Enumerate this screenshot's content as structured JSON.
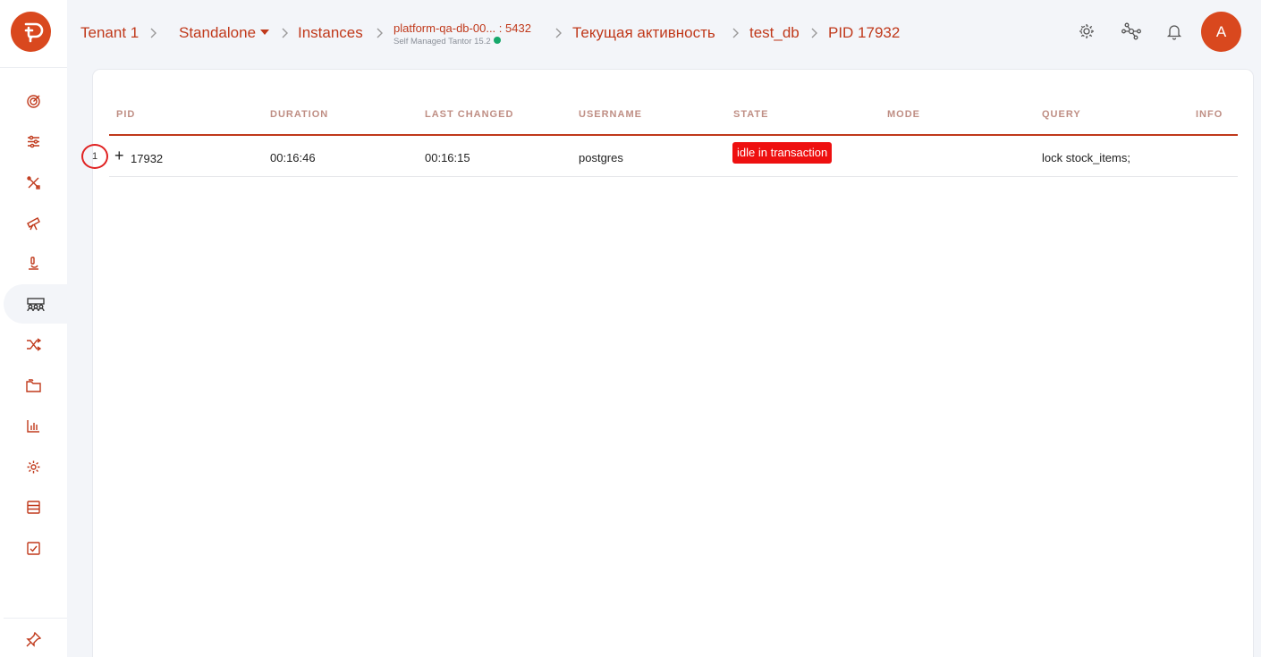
{
  "sidebar": {
    "items": [
      {
        "icon": "target-icon"
      },
      {
        "icon": "sliders-icon"
      },
      {
        "icon": "tools-icon"
      },
      {
        "icon": "telescope-icon"
      },
      {
        "icon": "microscope-icon"
      },
      {
        "icon": "users-icon",
        "active": true
      },
      {
        "icon": "shuffle-icon"
      },
      {
        "icon": "folders-icon"
      },
      {
        "icon": "bar-chart-icon"
      },
      {
        "icon": "gear-icon"
      },
      {
        "icon": "database-icon"
      },
      {
        "icon": "checklist-icon"
      }
    ],
    "pin_icon": "pin-icon"
  },
  "header": {
    "breadcrumbs": {
      "tenant": "Tenant 1",
      "standalone": "Standalone",
      "instances": "Instances",
      "instance_name": "platform-qa-db-00... : 5432",
      "instance_sub": "Self Managed Tantor 15.2",
      "activity": "Текущая активность",
      "database": "test_db",
      "pid": "PID 17932"
    },
    "avatar_letter": "A"
  },
  "table": {
    "columns": [
      "PID",
      "DURATION",
      "LAST CHANGED",
      "USERNAME",
      "STATE",
      "MODE",
      "QUERY",
      "INFO"
    ],
    "rows": [
      {
        "pid": "17932",
        "duration": "00:16:46",
        "last_changed": "00:16:15",
        "username": "postgres",
        "state": "idle in transaction",
        "mode": "",
        "query": "lock stock_items;",
        "info": ""
      }
    ]
  },
  "annotation": {
    "label": "1"
  },
  "colors": {
    "accent": "#c0391b",
    "brand": "#d9481e",
    "state_badge": "#ee1010",
    "ok": "#17a86b"
  }
}
